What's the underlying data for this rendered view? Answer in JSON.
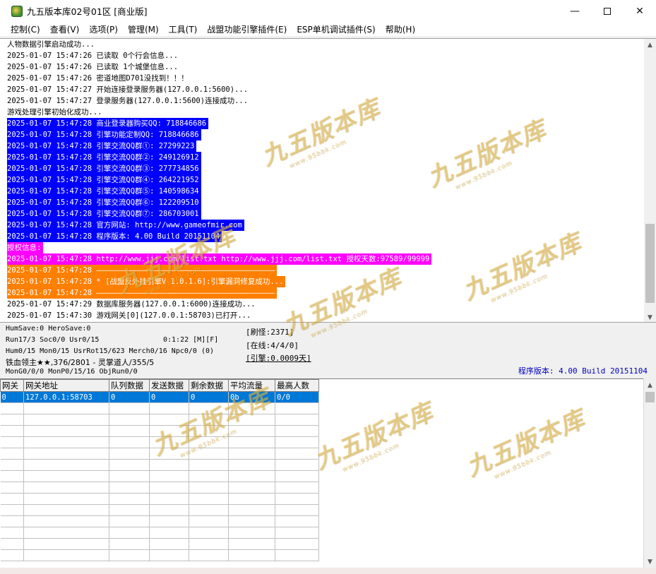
{
  "window": {
    "title": "九五版本库02号01区 [商业版]",
    "controls": {
      "minimize": "—",
      "maximize": "",
      "close": "✕"
    }
  },
  "menu": [
    "控制(C)",
    "查看(V)",
    "选项(P)",
    "管理(M)",
    "工具(T)",
    "战盟功能引擎插件(E)",
    "ESP单机调试插件(S)",
    "帮助(H)"
  ],
  "log": [
    {
      "text": "人物数据引擎启动成功...",
      "style": ""
    },
    {
      "text": "2025-01-07 15:47:26 已读取 0个行会信息...",
      "style": ""
    },
    {
      "text": "2025-01-07 15:47:26 已读取 1个城堡信息...",
      "style": ""
    },
    {
      "text": "2025-01-07 15:47:26 密道地图D701没找到！！！",
      "style": ""
    },
    {
      "text": "2025-01-07 15:47:27 开始连接登录服务器(127.0.0.1:5600)...",
      "style": ""
    },
    {
      "text": "2025-01-07 15:47:27 登录服务器(127.0.0.1:5600)连接成功...",
      "style": ""
    },
    {
      "text": "游戏处理引擎初始化成功...",
      "style": ""
    },
    {
      "text": "2025-01-07 15:47:28 商业登录器购买QQ: 718846686",
      "style": "blue"
    },
    {
      "text": "2025-01-07 15:47:28 引擎功能定制QQ: 718846686",
      "style": "blue"
    },
    {
      "text": "2025-01-07 15:47:28 引擎交流QQ群①: 27299223",
      "style": "blue"
    },
    {
      "text": "2025-01-07 15:47:28 引擎交流QQ群②: 249126912",
      "style": "blue"
    },
    {
      "text": "2025-01-07 15:47:28 引擎交流QQ群③: 277734856",
      "style": "blue"
    },
    {
      "text": "2025-01-07 15:47:28 引擎交流QQ群④: 264221952",
      "style": "blue"
    },
    {
      "text": "2025-01-07 15:47:28 引擎交流QQ群⑤: 140598634",
      "style": "blue"
    },
    {
      "text": "2025-01-07 15:47:28 引擎交流QQ群⑥: 122209510",
      "style": "blue"
    },
    {
      "text": "2025-01-07 15:47:28 引擎交流QQ群⑦: 286703001",
      "style": "blue"
    },
    {
      "text": "2025-01-07 15:47:28 官方网站: http://www.gameofmir.com",
      "style": "blue"
    },
    {
      "text": "2025-01-07 15:47:28 程序版本: 4.00 Build 20151104",
      "style": "blue"
    },
    {
      "text": "授权信息:",
      "style": "magenta"
    },
    {
      "text": "2025-01-07 15:47:28 http://www.jjj.com/list.txt http://www.jjj.com/list.txt 授权天数:97589/99999",
      "style": "magenta"
    },
    {
      "text": "2025-01-07 15:47:28 ————————————————————————————————————————",
      "style": "orange"
    },
    {
      "text": "2025-01-07 15:47:28 * [战盟反外挂引擎V 1.0.1.6]:引擎漏洞修复成功...",
      "style": "orange"
    },
    {
      "text": "2025-01-07 15:47:28 ————————————————————————————————————————",
      "style": "orange"
    },
    {
      "text": "2025-01-07 15:47:29 数据库服务器(127.0.0.1:6000)连接成功...",
      "style": ""
    },
    {
      "text": "2025-01-07 15:47:30 游戏网关[0](127.0.0.1:58703)已打开...",
      "style": ""
    }
  ],
  "status": {
    "line1": "HumSave:0 HeroSave:0",
    "line2": "Run17/3 Soc0/0 Usr0/15",
    "timer": "0:1:22 [M][F]",
    "line3": "Hum0/15 Mon0/15 UsrRot15/623 Merch0/16 Npc0/0 (0)",
    "line4": "铁血领主★★,376/2801 - 灵掌道人/355/5",
    "line5": "MonG0/0/0 MonP0/15/16 ObjRun0/0",
    "refresh": "[刷怪:2371]",
    "online": "[在线:4/4/0]",
    "engine": "[引擎:0.0009天]",
    "version": "程序版本: 4.00 Build 20151104"
  },
  "grid": {
    "headers": [
      "网关",
      "网关地址",
      "队列数据",
      "发送数据",
      "剩余数据",
      "平均流量",
      "最高人数"
    ],
    "rows": [
      [
        "0",
        "127.0.0.1:58703",
        "0",
        "0",
        "0",
        "0b",
        "0/0"
      ]
    ]
  },
  "watermark": {
    "text": "九五版本库",
    "sub": "www.95bbk.com"
  }
}
